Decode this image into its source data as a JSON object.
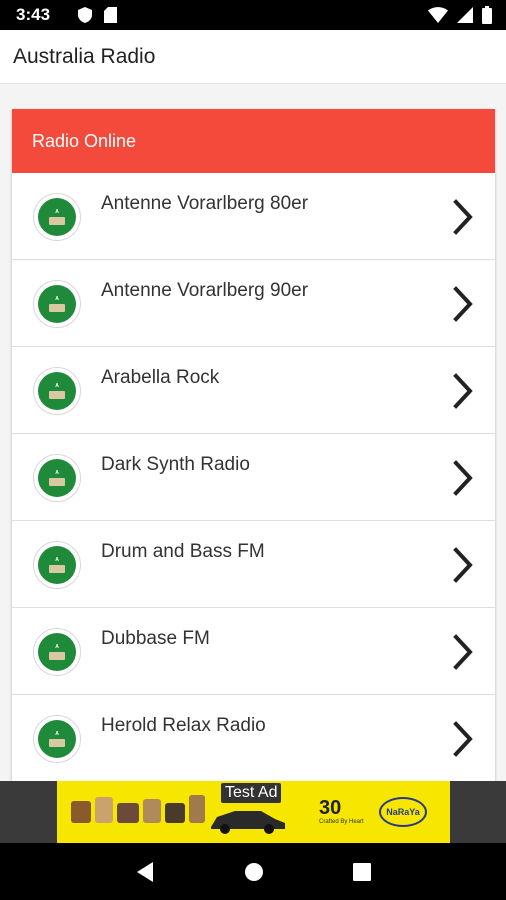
{
  "status_bar": {
    "time": "3:43",
    "icons": [
      "shield-icon",
      "sd-card-icon",
      "wifi-icon",
      "signal-icon",
      "battery-icon"
    ]
  },
  "app_bar": {
    "title": "Australia Radio"
  },
  "card": {
    "header": "Radio Online",
    "header_color": "#f34a3c",
    "stations": [
      {
        "name": "Antenne Vorarlberg 80er"
      },
      {
        "name": "Antenne Vorarlberg 90er"
      },
      {
        "name": "Arabella Rock"
      },
      {
        "name": "Dark Synth Radio"
      },
      {
        "name": "Drum and Bass FM"
      },
      {
        "name": "Dubbase FM"
      },
      {
        "name": "Herold Relax Radio"
      }
    ],
    "logo_icon": "station-logo-icon",
    "chevron_icon": "chevron-right-icon"
  },
  "ad": {
    "label": "Test Ad",
    "number": "30",
    "tagline": "Crafted By Heart",
    "brand": "NaRaYa",
    "background": "#f6e600"
  },
  "nav_bar": {
    "icons": [
      "back-icon",
      "home-icon",
      "recents-icon"
    ]
  }
}
